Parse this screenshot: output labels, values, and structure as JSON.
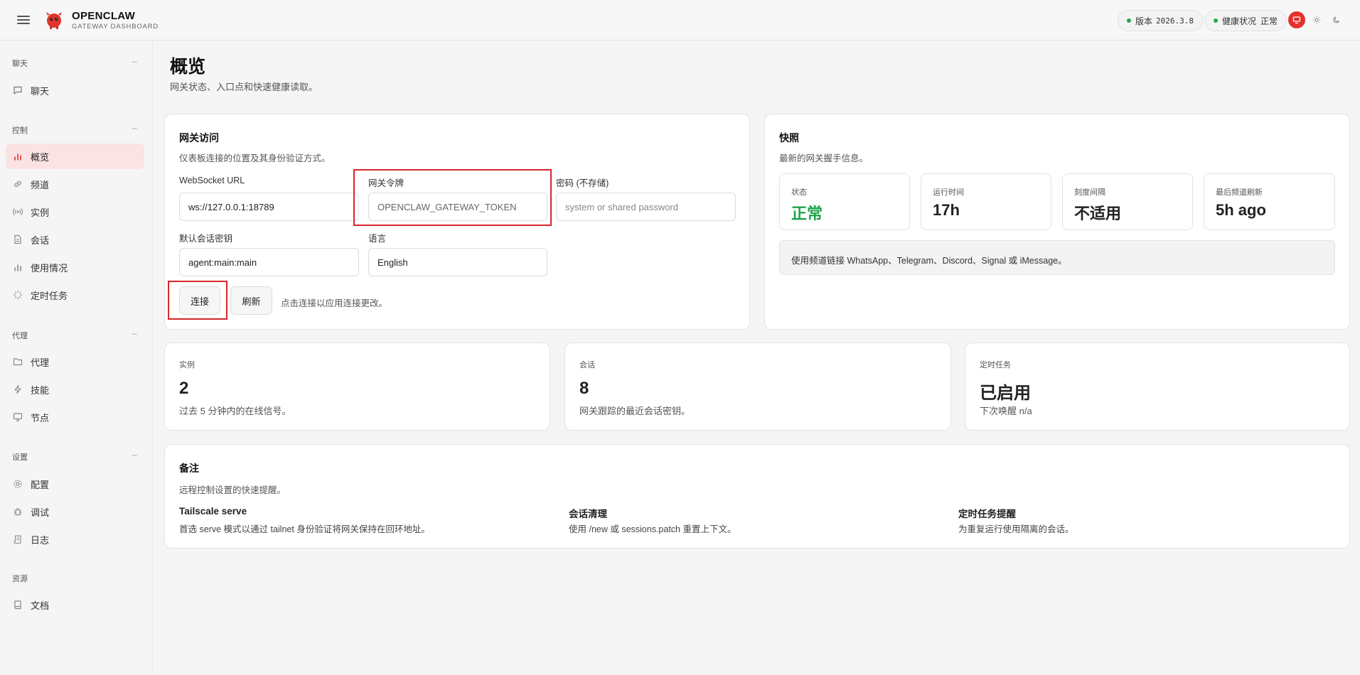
{
  "header": {
    "brand_title": "OPENCLAW",
    "brand_sub": "GATEWAY DASHBOARD",
    "version_label": "版本",
    "version_value": "2026.3.8",
    "health_label": "健康状况",
    "health_value": "正常"
  },
  "sidebar": {
    "groups": [
      {
        "label": "聊天",
        "collapse": "–",
        "items": [
          {
            "label": "聊天",
            "icon": "chat-icon"
          }
        ]
      },
      {
        "label": "控制",
        "collapse": "–",
        "items": [
          {
            "label": "概览",
            "icon": "bar-chart-icon"
          },
          {
            "label": "频道",
            "icon": "link-icon"
          },
          {
            "label": "实例",
            "icon": "radio-icon"
          },
          {
            "label": "会话",
            "icon": "document-icon"
          },
          {
            "label": "使用情况",
            "icon": "bar-chart-icon"
          },
          {
            "label": "定时任务",
            "icon": "loader-icon"
          }
        ]
      },
      {
        "label": "代理",
        "collapse": "–",
        "items": [
          {
            "label": "代理",
            "icon": "folder-icon"
          },
          {
            "label": "技能",
            "icon": "lightning-icon"
          },
          {
            "label": "节点",
            "icon": "monitor-icon"
          }
        ]
      },
      {
        "label": "设置",
        "collapse": "–",
        "items": [
          {
            "label": "配置",
            "icon": "gear-icon"
          },
          {
            "label": "调试",
            "icon": "bug-icon"
          },
          {
            "label": "日志",
            "icon": "scroll-icon"
          }
        ]
      },
      {
        "label": "资源",
        "items": [
          {
            "label": "文档",
            "icon": "book-icon"
          }
        ]
      }
    ]
  },
  "page": {
    "title": "概览",
    "subtitle": "网关状态、入口点和快速健康读取。"
  },
  "gateway_access": {
    "title": "网关访问",
    "subtitle": "仪表板连接的位置及其身份验证方式。",
    "ws_label": "WebSocket URL",
    "ws_value": "ws://127.0.0.1:18789",
    "token_label": "网关令牌",
    "token_value": "OPENCLAW_GATEWAY_TOKEN",
    "password_label": "密码 (不存储)",
    "password_placeholder": "system or shared password",
    "session_key_label": "默认会话密钥",
    "session_key_value": "agent:main:main",
    "language_label": "语言",
    "language_value": "English",
    "connect_button": "连接",
    "refresh_button": "刷新",
    "hint": "点击连接以应用连接更改。"
  },
  "snapshot": {
    "title": "快照",
    "subtitle": "最新的网关握手信息。",
    "stats": [
      {
        "label": "状态",
        "value": "正常"
      },
      {
        "label": "运行时间",
        "value": "17h"
      },
      {
        "label": "刻度间隔",
        "value": "不适用"
      },
      {
        "label": "最后频道刷新",
        "value": "5h ago"
      }
    ],
    "info": "使用频道链接 WhatsApp、Telegram、Discord、Signal 或 iMessage。"
  },
  "metrics": [
    {
      "label": "实例",
      "value": "2",
      "sub": "过去 5 分钟内的在线信号。"
    },
    {
      "label": "会话",
      "value": "8",
      "sub": "网关跟踪的最近会话密钥。"
    },
    {
      "label": "定时任务",
      "value": "已启用",
      "sub": "下次唤醒 n/a"
    }
  ],
  "notes": {
    "title": "备注",
    "subtitle": "远程控制设置的快速提醒。",
    "items": [
      {
        "title": "Tailscale serve",
        "text": "首选 serve 模式以通过 tailnet 身份验证将网关保持在回环地址。"
      },
      {
        "title": "会话清理",
        "text": "使用 /new 或 sessions.patch 重置上下文。"
      },
      {
        "title": "定时任务提醒",
        "text": "为重复运行使用隔离的会话。"
      }
    ]
  },
  "colors": {
    "accent": "#e5322d",
    "status_ok": "#1ca34a",
    "active_nav_bg": "#fbe3e3",
    "annotation_box": "#d9262b"
  }
}
